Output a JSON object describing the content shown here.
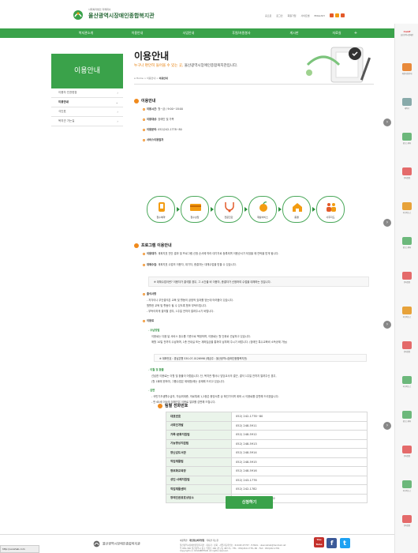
{
  "header": {
    "logo_sub": "사회복지법인 자제회사",
    "logo_main": "울산광역시장애인종합복지관",
    "util_links": [
      "홈으로",
      "로그인",
      "회원가입",
      "사이트맵",
      "ENGLISH"
    ],
    "util_colors": [
      "#e35a2a",
      "#f39c12",
      "#e35a2a"
    ]
  },
  "nav": {
    "items": [
      "복지관소개",
      "이용안내",
      "사업안내",
      "후원/자원봉사",
      "게시판",
      "자료실"
    ],
    "plus": "+"
  },
  "sidebar": {
    "title": "이용안내",
    "items": [
      {
        "label": "이용자 인권헌장",
        "active": false
      },
      {
        "label": "이용안내",
        "active": true
      },
      {
        "label": "식단표",
        "active": false
      },
      {
        "label": "복지관 가는길",
        "active": false
      }
    ]
  },
  "page": {
    "title": "이용안내",
    "subtitle_lead": "누구나 편안히 들어올 수 있는 곳,",
    "subtitle_rest": " 울산광역시장애인종합복지관입니다.",
    "breadcrumb": [
      "Home",
      "이용안내"
    ],
    "breadcrumb_current": "이용안내"
  },
  "usage": {
    "heading": "이용안내",
    "hours_label": "이용시간",
    "hours_value": ": 월~금 / 9:00~18:00",
    "target_label": "이용대상",
    "target_value": ": 장애인 및 가족",
    "inquiry_label": "이용문의",
    "inquiry_value": ": 052)242-1778~80",
    "process_label": "서비스이용절차",
    "steps": [
      "접수예약",
      "접수상담",
      "전문진단",
      "재활서비스",
      "종결",
      "사후지도"
    ]
  },
  "program": {
    "heading": "프로그램 이용안내",
    "waiting_label": "이용대기",
    "waiting_text": ": 계획지표 전단 결과 및 프로그램 신청 순서에 따라 대기자로 등록되며 이용순서가 되었을 때 연락을 받게 됩니다.",
    "replace_label": "대체수업",
    "replace_text": ": 계획지표 수업의 이용자, 대기자, 종결자는 대체수업을 받을 수 있습니다.",
    "box_text": "※ 대체수업이란? 이용자가 결석할 경우, 그 시간을 비 이용자, 종결자가 신청하여 수업을 대체하는 것입니다.",
    "attend_heading": "출석사항",
    "attend_lines": [
      "- 지각이나 무단결석은 교육 및 활동의 궁정적 효과를 얻는데 어려움이 있습니다.",
      "  원활한 교육 및 활동이 될 수 있도록 협조 부탁드립니다.",
      "- 부득이하게 결석할 경우, 1주일 전까지 알려주시기 바랍니다."
    ],
    "fee_heading": "이용료",
    "pay_heading": "수납방법",
    "pay_lines": [
      "이용료는 다음 달 서비스 횟수를 기준으로 책정하며, 이용료는 월 단위로 선납하고 있습니다.",
      "매월 10일 전까지 수납하며, 1층 안내실 또는 계좌입금을 통하여 납부해 주시기 바랍니다. (장애인 특수교육비 소득공제 가능)"
    ],
    "account_text": "※ 계좌번호 : 경남은행 530-07-0126998 (예금주 : 울산광역시장애인종합복지관)",
    "refund_heading": "이월 및 환불",
    "refund_lines": [
      "선납한 이용료는 이월 및 환불이 어렵습니다. 단, 복지관 행사나 담당교사의 결근, 결석 1주일 전까지 알려주신 경우,",
      "(월 1회에 한하여, 그룹수업은 제외함)에는 공제해 드리고 있습니다."
    ],
    "discount_heading": "감면",
    "discount_lines": [
      "- 국민기초생활수급자, 차상위계층, 의료특례 1,2종은 증빙서류 상 확인가이며 계좌 시 이용료를 감면해 드리겠습니다.",
      "- 만 65세 이상의 장애인은 이용료 일부를 감면해 드립니다."
    ]
  },
  "phones": {
    "heading": "팀별 전화번호",
    "rows": [
      {
        "team": "대표번호",
        "number": "052) 242-1778~80"
      },
      {
        "team": "사회인개발",
        "number": "052) 248-5911"
      },
      {
        "team": "가족·문화지원팀",
        "number": "052) 248-5912"
      },
      {
        "team": "기능향상지원팀",
        "number": "052) 248-5913"
      },
      {
        "team": "장난감도서관",
        "number": "052) 248-5914"
      },
      {
        "team": "직업재활팀",
        "number": "052) 248-5915"
      },
      {
        "team": "정보화교육장",
        "number": "052) 248-5916"
      },
      {
        "team": "성인·사례지원팀",
        "number": "052) 243-1776"
      },
      {
        "team": "직업재활센터",
        "number": "052) 242-1782"
      },
      {
        "team": "장애인권옹호상담소",
        "number": "1588-0420 / 052) 245-8692"
      }
    ]
  },
  "apply_button": "신청하기",
  "footer": {
    "logo_text": "울산광역시장애인종합복지관",
    "links": [
      "이용약관",
      "개인정보처리방침",
      "복지관 가는길"
    ],
    "lines": [
      "울산광역시장애인종합복지관 · 대표자 : 정회 · 사업자등록번호 : 610-82-07747 · E-MAIL : ulsanrehab@hanmail.net",
      "우 681-300 울산광역시 중구 학성로 160 (반구동 487-5) · TEL : 052)242-1778~80 · FAX : 052)242-1781",
      "Copyright (c) ULSANREHAB. All rights reserved."
    ],
    "social": [
      "You Tube",
      "f",
      "t"
    ],
    "status_url": "http://usrehab.com"
  },
  "right_panel": {
    "logo": "Canif",
    "logo_sub": "울산광역시장애인",
    "items": [
      "재정지원안내",
      "세탁기",
      "홈뉴스레터",
      "행사일정",
      "미디어뉴스",
      "홈뉴스레터",
      "행사일정",
      "미디어뉴스",
      "행사일정",
      "미디어뉴스",
      "홈뉴스레터",
      "행사일정",
      "미디어뉴스",
      "행사일정"
    ],
    "item_colors": [
      "#e8893a",
      "#8aa",
      "#6cb87b",
      "#e46a6a",
      "#e7a23a",
      "#6cb87b",
      "#e46a6a",
      "#e7a23a",
      "#e46a6a",
      "#6cb87b",
      "#6cb87b",
      "#e46a6a",
      "#6cb87b",
      "#e46a6a"
    ]
  }
}
